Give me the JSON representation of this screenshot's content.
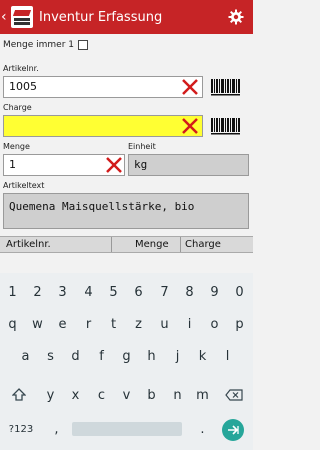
{
  "app": {
    "title": "Inventur Erfassung",
    "accent_color": "#c62426"
  },
  "options": {
    "menge_immer_1_label": "Menge immer 1",
    "menge_immer_1_checked": false
  },
  "form": {
    "artikelnr": {
      "label": "Artikelnr.",
      "value": "1005"
    },
    "charge": {
      "label": "Charge",
      "value": ""
    },
    "menge": {
      "label": "Menge",
      "value": "1"
    },
    "einheit": {
      "label": "Einheit",
      "value": "kg"
    },
    "artikeltext": {
      "label": "Artikeltext",
      "value": "Quemena Maisquellstärke, bio"
    }
  },
  "table": {
    "columns": [
      "Artikelnr.",
      "Menge",
      "Charge"
    ]
  },
  "keyboard": {
    "row_numbers": [
      "1",
      "2",
      "3",
      "4",
      "5",
      "6",
      "7",
      "8",
      "9",
      "0"
    ],
    "row_q": [
      "q",
      "w",
      "e",
      "r",
      "t",
      "z",
      "u",
      "i",
      "o",
      "p"
    ],
    "row_a": [
      "a",
      "s",
      "d",
      "f",
      "g",
      "h",
      "j",
      "k",
      "l"
    ],
    "row_y": [
      "y",
      "x",
      "c",
      "v",
      "b",
      "n",
      "m"
    ],
    "symbols_label": "?123",
    "comma": ",",
    "period": "."
  }
}
